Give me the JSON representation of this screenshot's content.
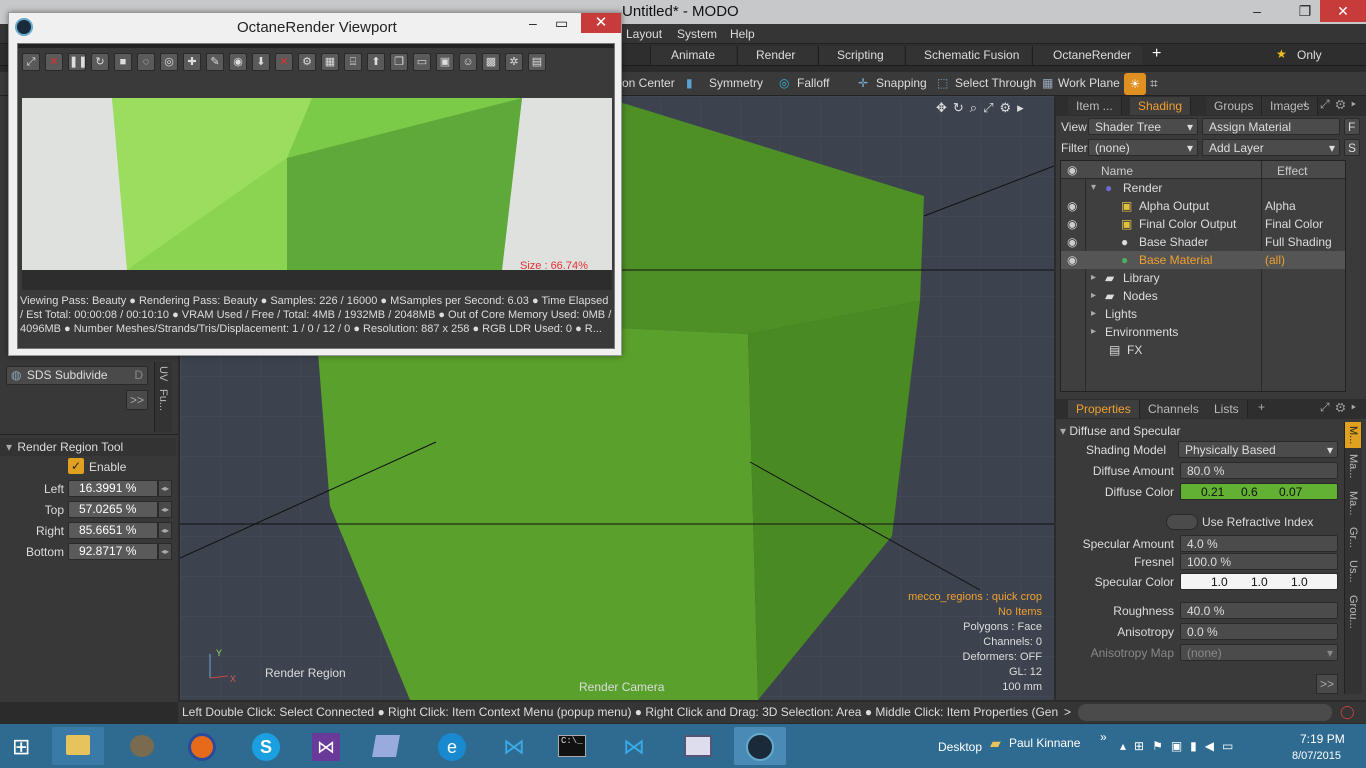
{
  "window": {
    "title": "Untitled* - MODO",
    "min": "–",
    "max": "❐",
    "close": "✕"
  },
  "menu": {
    "items": [
      "Layout",
      "System",
      "Help"
    ]
  },
  "layout_tabs": [
    "Animate",
    "Render",
    "Scripting",
    "Schematic Fusion",
    "OctaneRender"
  ],
  "add_tab": "+",
  "only_label": "Only",
  "toolbar": {
    "items": [
      "on Center",
      "Symmetry",
      "Falloff",
      "Snapping",
      "Select Through",
      "Work Plane"
    ]
  },
  "left": {
    "sds_label": "SDS Subdivide",
    "sds_key": "D",
    "side_tabs": [
      "UV",
      "Fu..."
    ],
    "more": ">>",
    "section": "Render Region Tool",
    "enable_label": "Enable",
    "fields": [
      {
        "label": "Left",
        "value": "16.3991 %"
      },
      {
        "label": "Top",
        "value": "57.0265 %"
      },
      {
        "label": "Right",
        "value": "85.6651 %"
      },
      {
        "label": "Bottom",
        "value": "92.8717 %"
      }
    ]
  },
  "viewport": {
    "camera_label": "Render Camera",
    "region_label": "Render Region",
    "info": [
      "mecco_regions : quick crop",
      "No Items",
      "Polygons : Face",
      "Channels: 0",
      "Deformers: OFF",
      "GL: 12",
      "100 mm"
    ],
    "cube_color": "#5a9a2a"
  },
  "shader": {
    "tabs": [
      "Item ...",
      "Shading",
      "Groups",
      "Images"
    ],
    "add": "+",
    "view_label": "View",
    "view_value": "Shader Tree",
    "assign_material": "Assign Material",
    "f_btn": "F",
    "filter_label": "Filter",
    "filter_value": "(none)",
    "add_layer": "Add Layer",
    "s_btn": "S",
    "col_name": "Name",
    "col_effect": "Effect",
    "rows": [
      {
        "name": "Render",
        "effect": ""
      },
      {
        "name": "Alpha Output",
        "effect": "Alpha"
      },
      {
        "name": "Final Color Output",
        "effect": "Final Color"
      },
      {
        "name": "Base Shader",
        "effect": "Full Shading"
      },
      {
        "name": "Base Material",
        "effect": "(all)"
      },
      {
        "name": "Library",
        "effect": ""
      },
      {
        "name": "Nodes",
        "effect": ""
      },
      {
        "name": "Lights",
        "effect": ""
      },
      {
        "name": "Environments",
        "effect": ""
      },
      {
        "name": "FX",
        "effect": ""
      }
    ]
  },
  "props": {
    "tabs": [
      "Properties",
      "Channels",
      "Lists"
    ],
    "add": "+",
    "section": "Diffuse and Specular",
    "shading_model_label": "Shading Model",
    "shading_model": "Physically Based",
    "diffuse_amount_label": "Diffuse Amount",
    "diffuse_amount": "80.0 %",
    "diffuse_color_label": "Diffuse Color",
    "diffuse_color": [
      "0.21",
      "0.6",
      "0.07"
    ],
    "refractive": "Use Refractive Index",
    "specular_amount_label": "Specular Amount",
    "specular_amount": "4.0 %",
    "fresnel_label": "Fresnel",
    "fresnel": "100.0 %",
    "specular_color_label": "Specular Color",
    "specular_color": [
      "1.0",
      "1.0",
      "1.0"
    ],
    "roughness_label": "Roughness",
    "roughness": "40.0 %",
    "anisotropy_label": "Anisotropy",
    "anisotropy": "0.0 %",
    "anisotropy_map_label": "Anisotropy Map",
    "anisotropy_map": "(none)",
    "side_tabs": [
      "M...",
      "Ma...",
      "Ma...",
      "Gr...",
      "Us...",
      "Grou..."
    ],
    "more": ">>"
  },
  "statusbar": {
    "text": "Left Double Click: Select Connected ● Right Click: Item Context Menu (popup menu) ● Right Click and Drag: 3D Selection: Area ● Middle Click: Item Properties (General) (popove...",
    "arrow": ">"
  },
  "octane": {
    "title": "OctaneRender Viewport",
    "size_text": "Size : 66.74%",
    "info": "Viewing Pass: Beauty ● Rendering Pass: Beauty ● Samples: 226  / 16000 ● MSamples per Second: 6.03 ● Time Elapsed / Est Total: 00:00:08 / 00:10:10 ● VRAM Used / Free / Total: 4MB / 1932MB / 2048MB ● Out of Core Memory Used: 0MB / 4096MB ● Number Meshes/Strands/Tris/Displacement: 1 / 0 / 12 / 0 ● Resolution: 887 x 258 ● RGB LDR Used: 0 ● R..."
  },
  "taskbar": {
    "desktop": "Desktop",
    "user": "Paul Kinnane",
    "time": "7:19 PM",
    "date": "8/07/2015",
    "chevron": "»"
  }
}
